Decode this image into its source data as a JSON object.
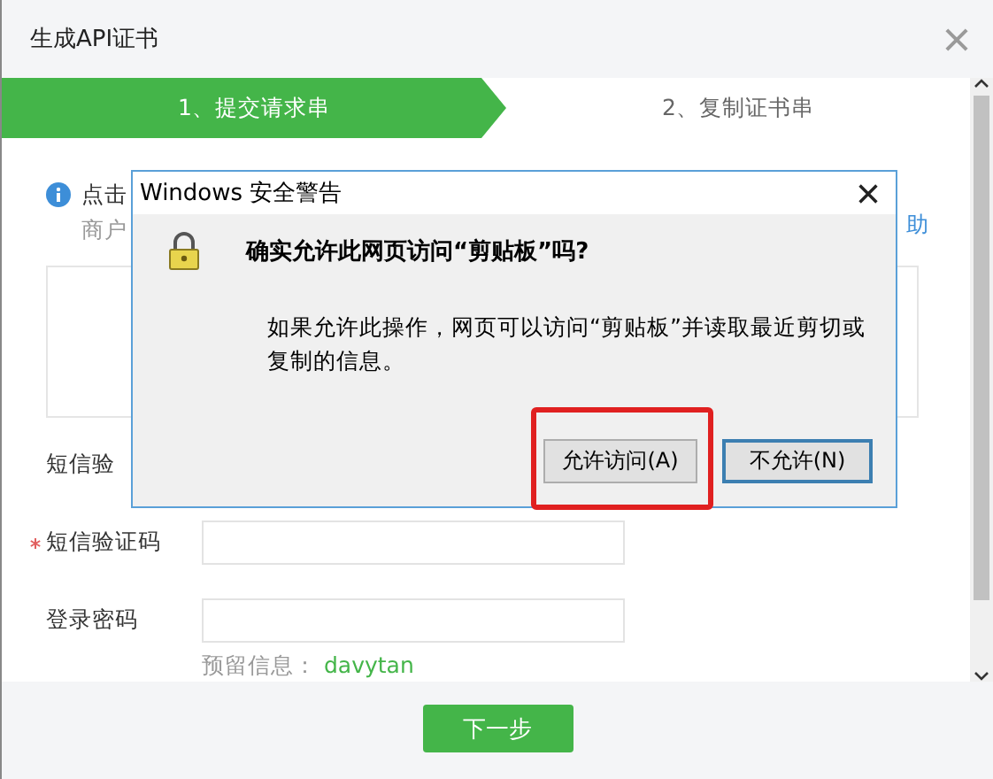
{
  "modal": {
    "title": "生成API证书"
  },
  "steps": [
    {
      "label": "1、提交请求串",
      "selected": true
    },
    {
      "label": "2、复制证书串",
      "selected": false
    }
  ],
  "notice": {
    "text": "点击",
    "subtext": "商户",
    "link": "助"
  },
  "fields": [
    {
      "label": "短信验",
      "required": false,
      "kind": "label_only"
    },
    {
      "label": "短信验证码",
      "required": true,
      "kind": "input"
    },
    {
      "label": "登录密码",
      "required": false,
      "kind": "input"
    }
  ],
  "reserved": {
    "label": "预留信息：",
    "value": "davytan"
  },
  "next_button": "下一步",
  "alert": {
    "title": "Windows 安全警告",
    "question": "确实允许此网页访问“剪贴板”吗?",
    "message": "如果允许此操作，网页可以访问“剪贴板”并读取最近剪切或复制的信息。",
    "buttons": [
      {
        "label": "允许访问(A)",
        "highlighted": true,
        "default": false
      },
      {
        "label": "不允许(N)",
        "highlighted": false,
        "default": true
      }
    ]
  }
}
